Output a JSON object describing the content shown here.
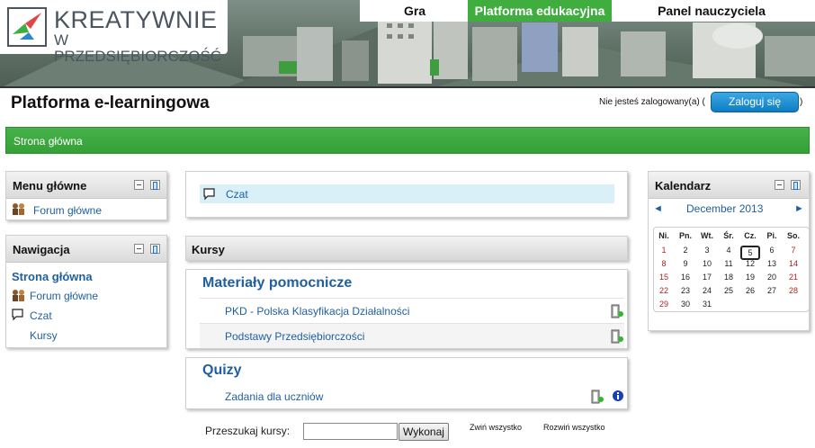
{
  "header": {
    "logo_line1": "KREATYWNIE",
    "logo_line2": "W PRZEDSIĘBIORCZOŚĆ",
    "nav": [
      {
        "label": "Gra"
      },
      {
        "label": "Platforma edukacyjna",
        "active": true
      },
      {
        "label": "Panel nauczyciela"
      }
    ]
  },
  "page": {
    "title": "Platforma e-learningowa",
    "login_info": "Nie jesteś zalogowany(a) (",
    "login_button": "Zaloguj się",
    "login_close": ")",
    "breadcrumb": "Strona główna"
  },
  "left": {
    "main_menu": {
      "title": "Menu główne",
      "items": [
        {
          "label": "Forum główne",
          "icon": "forum-icon"
        }
      ]
    },
    "navigation": {
      "title": "Nawigacja",
      "home": "Strona główna",
      "items": [
        {
          "label": "Forum główne",
          "icon": "forum-icon"
        },
        {
          "label": "Czat",
          "icon": "chat-icon"
        },
        {
          "label": "Kursy"
        }
      ]
    }
  },
  "center": {
    "site_item": {
      "label": "Czat",
      "icon": "chat-icon"
    },
    "courses_title": "Kursy",
    "categories": [
      {
        "name": "Materiały pomocnicze",
        "courses": [
          "PKD - Polska Klasyfikacja Działalności",
          "Podstawy Przedsiębiorczości"
        ]
      },
      {
        "name": "Quizy",
        "courses": [
          "Zadania dla uczniów"
        ]
      }
    ],
    "search_label": "Przeszukaj kursy:",
    "search_value": "",
    "search_button": "Wykonaj",
    "collapse_all": "Zwiń wszystko",
    "expand_all": "Rozwiń wszystko"
  },
  "calendar": {
    "title": "Kalendarz",
    "month": "December 2013",
    "prev": "◄",
    "next": "►",
    "weekdays": [
      "Ni.",
      "Pn.",
      "Wt.",
      "Śr.",
      "Cz.",
      "Pi.",
      "So."
    ],
    "weeks": [
      [
        "1",
        "2",
        "3",
        "4",
        "5",
        "6",
        "7"
      ],
      [
        "8",
        "9",
        "10",
        "11",
        "12",
        "13",
        "14"
      ],
      [
        "15",
        "16",
        "17",
        "18",
        "19",
        "20",
        "21"
      ],
      [
        "22",
        "23",
        "24",
        "25",
        "26",
        "27",
        "28"
      ],
      [
        "29",
        "30",
        "31",
        "",
        "",
        "",
        ""
      ]
    ],
    "today": "5"
  },
  "colors": {
    "accent_green": "#3fae3f",
    "link_blue": "#1f5f9e",
    "login_blue": "#0d7dc4",
    "weekend_red": "#b22222"
  }
}
